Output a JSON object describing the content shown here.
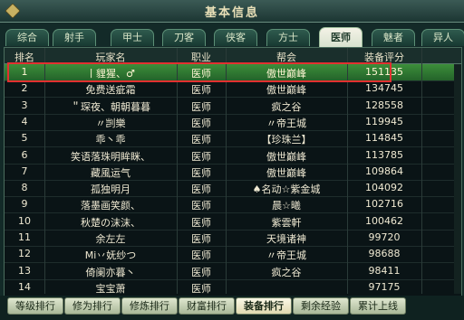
{
  "window": {
    "title": "基本信息"
  },
  "tabs": [
    {
      "label": "综合",
      "active": false
    },
    {
      "label": "射手",
      "active": false
    },
    {
      "label": "甲士",
      "active": false
    },
    {
      "label": "刀客",
      "active": false
    },
    {
      "label": "侠客",
      "active": false
    },
    {
      "label": "方士",
      "active": false
    },
    {
      "label": "医师",
      "active": true
    },
    {
      "label": "魅者",
      "active": false
    },
    {
      "label": "异人",
      "active": false
    }
  ],
  "table": {
    "headers": {
      "rank": "排名",
      "name": "玩家名",
      "job": "职业",
      "guild": "帮会",
      "score": "装备评分"
    },
    "rows": [
      {
        "rank": "1",
        "name": "丨貍猩、♂",
        "job": "医师",
        "guild": "傲世巅峰",
        "score": "151135",
        "selected": true
      },
      {
        "rank": "2",
        "name": "免费送疵霜",
        "job": "医师",
        "guild": "傲世巅峰",
        "score": "134745"
      },
      {
        "rank": "3",
        "name": "＂琛夜、朝朝暮暮",
        "job": "医师",
        "guild": "疯之谷",
        "score": "128558"
      },
      {
        "rank": "4",
        "name": "〃剀樂",
        "job": "医师",
        "guild": "〃帝王城",
        "score": "119945"
      },
      {
        "rank": "5",
        "name": "乖丶乖",
        "job": "医师",
        "guild": "【珍珠兰】",
        "score": "114845"
      },
      {
        "rank": "6",
        "name": "笑语落珠明眸眯、",
        "job": "医师",
        "guild": "傲世巅峰",
        "score": "113785"
      },
      {
        "rank": "7",
        "name": "藏風运气",
        "job": "医师",
        "guild": "傲世巅峰",
        "score": "109864"
      },
      {
        "rank": "8",
        "name": "孤独明月",
        "job": "医师",
        "guild": "♠名动☆紫金城",
        "score": "104092"
      },
      {
        "rank": "9",
        "name": "落墨画笑颜、",
        "job": "医师",
        "guild": "晨☆曦",
        "score": "102716"
      },
      {
        "rank": "10",
        "name": "秋楚の沫沫、",
        "job": "医师",
        "guild": "紫雲軒",
        "score": "100462"
      },
      {
        "rank": "11",
        "name": "余左左",
        "job": "医师",
        "guild": "天境诸神",
        "score": "99720"
      },
      {
        "rank": "12",
        "name": "Mi丷妩纱つ",
        "job": "医师",
        "guild": "〃帝王城",
        "score": "98688"
      },
      {
        "rank": "13",
        "name": "倚阑亦暮丶",
        "job": "医师",
        "guild": "疯之谷",
        "score": "98411"
      },
      {
        "rank": "14",
        "name": "宝宝萧",
        "job": "医师",
        "guild": "",
        "score": "97175"
      }
    ]
  },
  "bottom_buttons": [
    {
      "label": "等级排行",
      "active": false
    },
    {
      "label": "修为排行",
      "active": false
    },
    {
      "label": "修炼排行",
      "active": false
    },
    {
      "label": "财富排行",
      "active": false
    },
    {
      "label": "装备排行",
      "active": true
    },
    {
      "label": "剩余经验",
      "active": false
    },
    {
      "label": "累计上线",
      "active": false
    }
  ],
  "colors": {
    "selected_row": "#3c8e3a",
    "highlight_border": "#e23030"
  }
}
